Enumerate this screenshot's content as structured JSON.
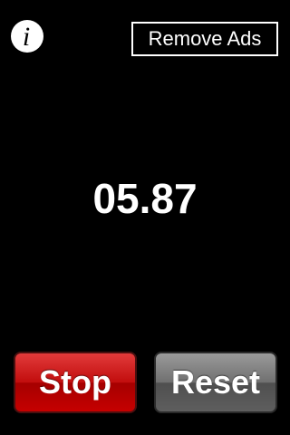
{
  "header": {
    "info_icon_glyph": "i",
    "remove_ads_label": "Remove Ads"
  },
  "timer": {
    "display": "05.87"
  },
  "controls": {
    "stop_label": "Stop",
    "reset_label": "Reset"
  },
  "colors": {
    "background": "#000000",
    "stop_button": "#c20d0d",
    "reset_button": "#707070",
    "text": "#ffffff"
  }
}
